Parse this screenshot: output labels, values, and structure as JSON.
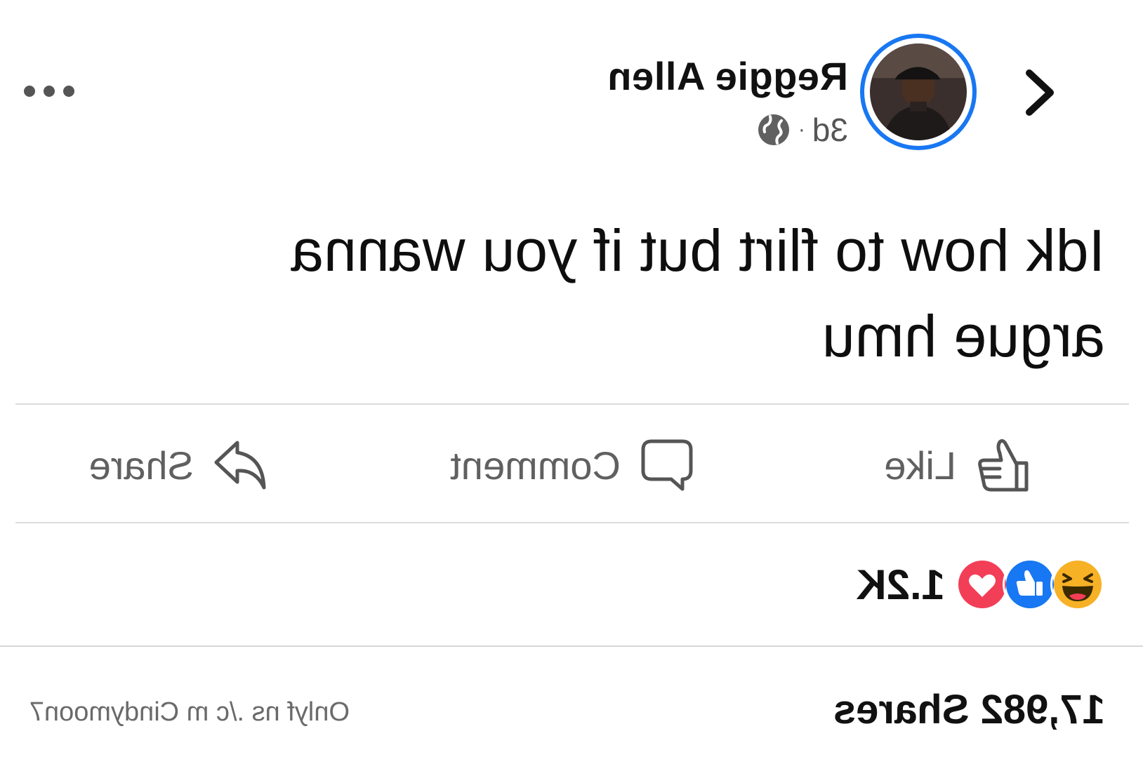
{
  "header": {
    "author_name": "Reggie Allen",
    "timestamp": "3d",
    "separator": "·",
    "audience_icon": "globe-icon",
    "back_icon": "chevron-icon",
    "more_icon": "more-dots-icon"
  },
  "post": {
    "text": "Idk how to flirt but if you wanna argue hmu"
  },
  "actions": {
    "like_label": "Like",
    "comment_label": "Comment",
    "share_label": "Share"
  },
  "reactions": {
    "icons": [
      "haha-reaction-icon",
      "like-reaction-icon",
      "love-reaction-icon"
    ],
    "count": "1.2K"
  },
  "footer": {
    "shares": "17,982 Shares",
    "watermark": "Onlyf ns ./c m Cindymoon7"
  },
  "colors": {
    "accent": "#1877f2",
    "love": "#f33e58",
    "haha": "#f7b125",
    "text": "#111111",
    "muted": "#606060"
  }
}
